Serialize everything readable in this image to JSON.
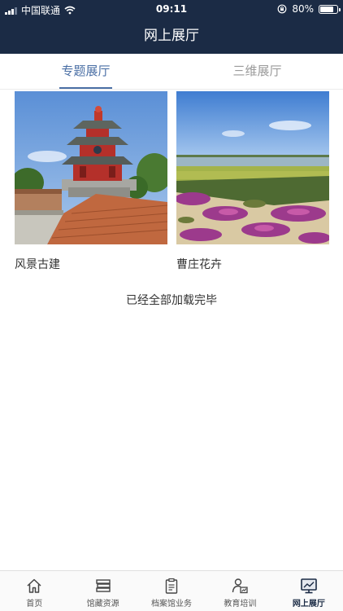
{
  "status_bar": {
    "carrier": "中国联通",
    "time": "09:11",
    "battery": "80%",
    "battery_level": 0.8
  },
  "header": {
    "title": "网上展厅"
  },
  "tabs": [
    {
      "label": "专题展厅",
      "active": true
    },
    {
      "label": "三维展厅",
      "active": false
    }
  ],
  "cards": [
    {
      "title": "风景古建",
      "image": "pavilion-photo"
    },
    {
      "title": "曹庄花卉",
      "image": "flower-field-photo"
    }
  ],
  "list_end_text": "已经全部加载完毕",
  "tabbar": [
    {
      "label": "首页",
      "icon": "home-icon",
      "active": false
    },
    {
      "label": "馆藏资源",
      "icon": "books-icon",
      "active": false
    },
    {
      "label": "档案馆业务",
      "icon": "clipboard-icon",
      "active": false
    },
    {
      "label": "教育培训",
      "icon": "person-chart-icon",
      "active": false
    },
    {
      "label": "网上展厅",
      "icon": "monitor-icon",
      "active": true
    }
  ],
  "colors": {
    "nav_bg": "#1b2b45",
    "accent": "#4a6fa5"
  }
}
